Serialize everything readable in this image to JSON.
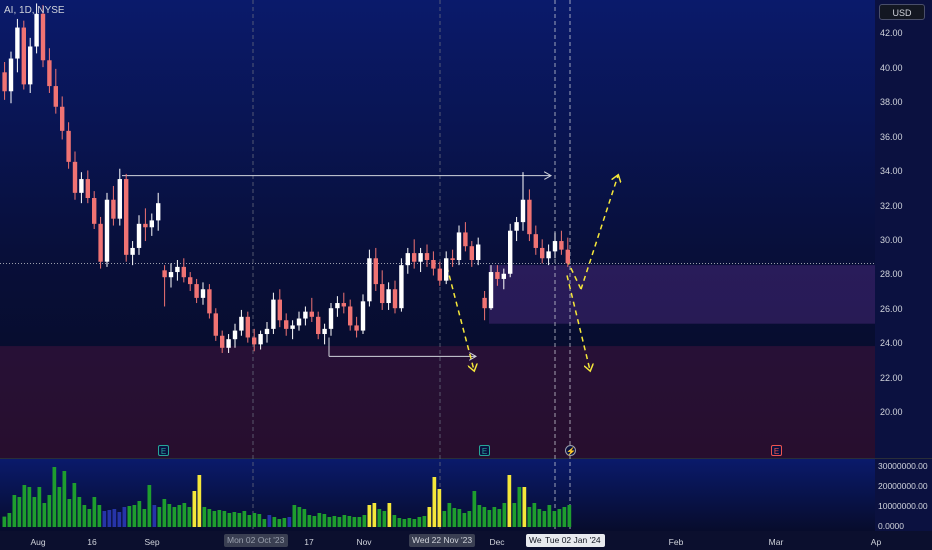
{
  "header": {
    "ticker_label": "AI, 1D, NYSE"
  },
  "price_scale": {
    "currency_button": "USD"
  },
  "chart_data": {
    "type": "candlestick",
    "price_ylim": [
      17.4,
      44.0
    ],
    "volume_ylim": [
      0,
      34000000
    ],
    "y_tick_labels": [
      "42.00",
      "40.00",
      "38.00",
      "36.00",
      "34.00",
      "32.00",
      "30.00",
      "28.00",
      "26.00",
      "24.00",
      "22.00",
      "20.00"
    ],
    "volume_tick_labels": [
      "30000000.00",
      "20000000.00",
      "10000000.00",
      "0.0000"
    ],
    "x_tick_labels": [
      "Aug",
      "16",
      "Sep",
      "Oct",
      "17",
      "Nov",
      "Dec",
      "Feb",
      "Mar",
      "Ap"
    ],
    "x_highlight_labels": [
      "Mon 02 Oct '23",
      "Wed 22 Nov '23",
      "Wed",
      "Tue 02 Jan '24"
    ],
    "last_price": 28.7,
    "colors": {
      "up": "#ffffff",
      "down": "#f07373",
      "volume_up": "#1e9e2e",
      "volume_mid": "#2634a8",
      "volume_hi": "#f5e73a",
      "arrow": "#f5e73a",
      "line": "#d1d4dc"
    },
    "candles_ohlc": [
      [
        39.8,
        40.4,
        38.2,
        38.7
      ],
      [
        38.7,
        41.0,
        38.0,
        40.6
      ],
      [
        40.6,
        42.9,
        39.8,
        42.4
      ],
      [
        42.4,
        42.8,
        38.8,
        39.1
      ],
      [
        39.1,
        41.8,
        38.6,
        41.3
      ],
      [
        41.3,
        43.8,
        40.9,
        43.2
      ],
      [
        43.2,
        43.7,
        40.1,
        40.5
      ],
      [
        40.5,
        41.2,
        38.6,
        39.0
      ],
      [
        39.0,
        40.0,
        37.4,
        37.8
      ],
      [
        37.8,
        38.4,
        35.9,
        36.4
      ],
      [
        36.4,
        36.9,
        34.2,
        34.6
      ],
      [
        34.6,
        35.2,
        32.4,
        32.8
      ],
      [
        32.8,
        34.0,
        32.2,
        33.6
      ],
      [
        33.6,
        34.1,
        32.2,
        32.5
      ],
      [
        32.5,
        32.9,
        30.7,
        31.0
      ],
      [
        31.0,
        31.4,
        28.4,
        28.8
      ],
      [
        28.8,
        32.8,
        28.5,
        32.4
      ],
      [
        32.4,
        33.2,
        30.9,
        31.3
      ],
      [
        31.3,
        34.2,
        30.9,
        33.6
      ],
      [
        33.6,
        33.9,
        28.8,
        29.2
      ],
      [
        29.2,
        30.0,
        28.6,
        29.6
      ],
      [
        29.6,
        31.5,
        29.2,
        31.0
      ],
      [
        31.0,
        31.9,
        30.0,
        30.8
      ],
      [
        30.8,
        31.6,
        30.3,
        31.2
      ],
      [
        31.2,
        32.8,
        30.6,
        32.2
      ],
      [
        28.3,
        28.6,
        26.2,
        27.9
      ],
      [
        27.9,
        28.7,
        27.3,
        28.2
      ],
      [
        28.2,
        28.9,
        27.7,
        28.5
      ],
      [
        28.5,
        29.0,
        27.6,
        27.9
      ],
      [
        27.9,
        28.2,
        27.1,
        27.5
      ],
      [
        27.5,
        27.8,
        26.4,
        26.7
      ],
      [
        26.7,
        27.6,
        26.3,
        27.2
      ],
      [
        27.2,
        27.5,
        25.5,
        25.8
      ],
      [
        25.8,
        26.1,
        24.2,
        24.5
      ],
      [
        24.5,
        24.8,
        23.5,
        23.8
      ],
      [
        23.8,
        24.6,
        23.5,
        24.3
      ],
      [
        24.3,
        25.2,
        23.8,
        24.8
      ],
      [
        24.8,
        26.0,
        24.5,
        25.6
      ],
      [
        25.6,
        25.9,
        24.1,
        24.4
      ],
      [
        24.4,
        24.9,
        23.6,
        24.0
      ],
      [
        24.0,
        24.8,
        23.7,
        24.6
      ],
      [
        24.6,
        25.3,
        24.1,
        24.9
      ],
      [
        24.9,
        27.0,
        24.6,
        26.6
      ],
      [
        26.6,
        27.2,
        25.0,
        25.4
      ],
      [
        25.4,
        25.8,
        24.5,
        24.9
      ],
      [
        24.9,
        25.4,
        24.3,
        25.1
      ],
      [
        25.1,
        25.9,
        24.8,
        25.5
      ],
      [
        25.5,
        26.2,
        25.1,
        25.9
      ],
      [
        25.9,
        26.7,
        25.3,
        25.6
      ],
      [
        25.6,
        25.9,
        24.3,
        24.6
      ],
      [
        24.6,
        25.2,
        24.0,
        24.9
      ],
      [
        24.9,
        26.4,
        24.5,
        26.1
      ],
      [
        26.1,
        26.8,
        25.6,
        26.4
      ],
      [
        26.4,
        27.0,
        25.8,
        26.2
      ],
      [
        26.2,
        26.6,
        24.8,
        25.1
      ],
      [
        25.1,
        25.6,
        24.4,
        24.8
      ],
      [
        24.8,
        26.9,
        24.6,
        26.5
      ],
      [
        26.5,
        29.5,
        26.2,
        29.0
      ],
      [
        29.0,
        29.6,
        27.1,
        27.5
      ],
      [
        27.5,
        28.3,
        26.0,
        26.4
      ],
      [
        26.4,
        27.6,
        26.0,
        27.2
      ],
      [
        27.2,
        27.7,
        25.8,
        26.1
      ],
      [
        26.1,
        29.0,
        25.9,
        28.6
      ],
      [
        28.6,
        29.6,
        28.1,
        29.3
      ],
      [
        29.3,
        30.1,
        28.4,
        28.8
      ],
      [
        28.8,
        29.6,
        28.2,
        29.3
      ],
      [
        29.3,
        29.8,
        28.5,
        28.9
      ],
      [
        28.9,
        29.4,
        28.0,
        28.4
      ],
      [
        28.4,
        28.8,
        27.4,
        27.7
      ],
      [
        27.7,
        29.4,
        27.5,
        29.0
      ],
      [
        29.0,
        29.5,
        28.5,
        28.9
      ],
      [
        28.9,
        30.9,
        28.6,
        30.5
      ],
      [
        30.5,
        31.1,
        29.4,
        29.7
      ],
      [
        29.7,
        30.0,
        28.5,
        28.9
      ],
      [
        28.9,
        30.2,
        28.6,
        29.8
      ],
      [
        26.7,
        27.1,
        25.4,
        26.1
      ],
      [
        26.1,
        28.6,
        26.0,
        28.2
      ],
      [
        28.2,
        28.6,
        27.4,
        27.8
      ],
      [
        27.8,
        28.4,
        27.2,
        28.1
      ],
      [
        28.1,
        31.0,
        27.9,
        30.6
      ],
      [
        30.6,
        31.4,
        30.0,
        31.1
      ],
      [
        31.1,
        34.0,
        30.6,
        32.4
      ],
      [
        32.4,
        33.0,
        30.0,
        30.4
      ],
      [
        30.4,
        30.9,
        29.2,
        29.6
      ],
      [
        29.6,
        30.1,
        28.7,
        29.0
      ],
      [
        29.0,
        29.8,
        28.6,
        29.4
      ],
      [
        29.4,
        30.5,
        29.0,
        30.0
      ],
      [
        30.0,
        30.6,
        29.2,
        29.5
      ],
      [
        29.5,
        30.2,
        28.5,
        28.7
      ]
    ],
    "volume": [
      [
        5200000,
        "up"
      ],
      [
        7000000,
        "up"
      ],
      [
        16000000,
        "up"
      ],
      [
        15000000,
        "up"
      ],
      [
        21000000,
        "up"
      ],
      [
        20000000,
        "up"
      ],
      [
        15000000,
        "up"
      ],
      [
        20000000,
        "up"
      ],
      [
        12000000,
        "up"
      ],
      [
        16000000,
        "up"
      ],
      [
        30000000,
        "up"
      ],
      [
        20000000,
        "up"
      ],
      [
        28000000,
        "up"
      ],
      [
        14000000,
        "up"
      ],
      [
        22000000,
        "up"
      ],
      [
        15000000,
        "up"
      ],
      [
        11000000,
        "up"
      ],
      [
        9000000,
        "up"
      ],
      [
        15000000,
        "up"
      ],
      [
        11000000,
        "up"
      ],
      [
        8000000,
        "mid"
      ],
      [
        8500000,
        "mid"
      ],
      [
        9000000,
        "mid"
      ],
      [
        7500000,
        "mid"
      ],
      [
        10000000,
        "mid"
      ],
      [
        10500000,
        "up"
      ],
      [
        11000000,
        "up"
      ],
      [
        13000000,
        "up"
      ],
      [
        9000000,
        "up"
      ],
      [
        21000000,
        "up"
      ],
      [
        11000000,
        "mid"
      ],
      [
        10000000,
        "up"
      ],
      [
        14000000,
        "up"
      ],
      [
        11500000,
        "up"
      ],
      [
        10000000,
        "up"
      ],
      [
        11000000,
        "up"
      ],
      [
        12000000,
        "up"
      ],
      [
        10000000,
        "up"
      ],
      [
        18000000,
        "hi"
      ],
      [
        26000000,
        "hi"
      ],
      [
        10000000,
        "up"
      ],
      [
        9000000,
        "up"
      ],
      [
        8000000,
        "up"
      ],
      [
        8500000,
        "up"
      ],
      [
        8000000,
        "up"
      ],
      [
        7000000,
        "up"
      ],
      [
        7500000,
        "up"
      ],
      [
        7000000,
        "up"
      ],
      [
        8000000,
        "up"
      ],
      [
        6000000,
        "up"
      ],
      [
        7000000,
        "up"
      ],
      [
        6500000,
        "up"
      ],
      [
        4000000,
        "up"
      ],
      [
        6000000,
        "mid"
      ],
      [
        5000000,
        "up"
      ],
      [
        4000000,
        "up"
      ],
      [
        4500000,
        "up"
      ],
      [
        5000000,
        "mid"
      ],
      [
        11000000,
        "up"
      ],
      [
        10000000,
        "up"
      ],
      [
        9000000,
        "up"
      ],
      [
        6000000,
        "up"
      ],
      [
        5500000,
        "up"
      ],
      [
        7000000,
        "up"
      ],
      [
        6500000,
        "up"
      ],
      [
        5000000,
        "up"
      ],
      [
        5500000,
        "up"
      ],
      [
        5000000,
        "up"
      ],
      [
        6000000,
        "up"
      ],
      [
        5500000,
        "up"
      ],
      [
        5000000,
        "up"
      ],
      [
        5000000,
        "up"
      ],
      [
        6000000,
        "up"
      ],
      [
        11000000,
        "hi"
      ],
      [
        12000000,
        "hi"
      ],
      [
        9000000,
        "up"
      ],
      [
        8000000,
        "up"
      ],
      [
        12000000,
        "hi"
      ],
      [
        6000000,
        "up"
      ],
      [
        4500000,
        "up"
      ],
      [
        4000000,
        "up"
      ],
      [
        4500000,
        "up"
      ],
      [
        4000000,
        "up"
      ],
      [
        5000000,
        "up"
      ],
      [
        5500000,
        "up"
      ],
      [
        10000000,
        "hi"
      ],
      [
        25000000,
        "hi"
      ],
      [
        19000000,
        "hi"
      ],
      [
        8000000,
        "up"
      ],
      [
        12000000,
        "up"
      ],
      [
        9500000,
        "up"
      ],
      [
        9000000,
        "up"
      ],
      [
        7000000,
        "up"
      ],
      [
        8000000,
        "up"
      ],
      [
        18000000,
        "up"
      ],
      [
        11000000,
        "up"
      ],
      [
        10000000,
        "up"
      ],
      [
        8500000,
        "up"
      ],
      [
        10000000,
        "up"
      ],
      [
        9000000,
        "up"
      ],
      [
        12000000,
        "up"
      ],
      [
        26000000,
        "hi"
      ],
      [
        12000000,
        "up"
      ],
      [
        20000000,
        "up"
      ],
      [
        20000000,
        "hi"
      ],
      [
        10000000,
        "up"
      ],
      [
        12000000,
        "up"
      ],
      [
        9000000,
        "up"
      ],
      [
        8000000,
        "up"
      ],
      [
        11000000,
        "up"
      ],
      [
        8000000,
        "up"
      ],
      [
        9000000,
        "up"
      ],
      [
        10000000,
        "up"
      ],
      [
        11000000,
        "up"
      ]
    ],
    "zones": [
      {
        "name": "support-zone",
        "y_top": 23.9,
        "y_bottom": 17.4,
        "color": "rgba(110,25,70,0.32)"
      },
      {
        "name": "resistance-zone",
        "y_top": 28.6,
        "y_bottom": 25.2,
        "color": "rgba(120,60,170,0.30)"
      }
    ],
    "event_markers": [
      "E",
      "E",
      "⚡",
      "E"
    ]
  }
}
